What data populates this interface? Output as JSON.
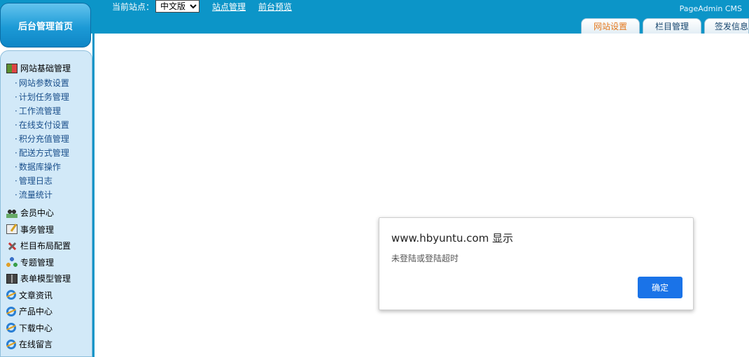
{
  "header": {
    "home_label": "后台管理首页",
    "site_label": "当前站点：",
    "site_selected": "中文版",
    "links": [
      "站点管理",
      "前台预览"
    ],
    "brand": "PageAdmin CMS"
  },
  "tabs": [
    {
      "label": "网站设置",
      "active": true
    },
    {
      "label": "栏目管理",
      "active": false
    },
    {
      "label": "签发信息",
      "active": false
    }
  ],
  "sidebar": {
    "group_title": "网站基础管理",
    "sub_items": [
      "网站参数设置",
      "计划任务管理",
      "工作流管理",
      "在线支付设置",
      "积分充值管理",
      "配送方式管理",
      "数据库操作",
      "管理日志",
      "流量统计"
    ],
    "items": [
      {
        "label": "会员中心",
        "icon": "people-icon"
      },
      {
        "label": "事务管理",
        "icon": "edit-icon"
      },
      {
        "label": "栏目布局配置",
        "icon": "tools-icon"
      },
      {
        "label": "专题管理",
        "icon": "org-icon"
      },
      {
        "label": "表单模型管理",
        "icon": "book-icon"
      },
      {
        "label": "文章资讯",
        "icon": "ie-icon"
      },
      {
        "label": "产品中心",
        "icon": "ie-icon"
      },
      {
        "label": "下载中心",
        "icon": "ie-icon"
      },
      {
        "label": "在线留言",
        "icon": "ie-icon"
      }
    ]
  },
  "dialog": {
    "title": "www.hbyuntu.com 显示",
    "message": "未登陆或登陆超时",
    "ok_label": "确定"
  },
  "colors": {
    "header_blue": "#0c95c8",
    "sidebar_bg": "#d2e9f8",
    "active_tab": "#e4781c",
    "dialog_button": "#1a73e8"
  }
}
